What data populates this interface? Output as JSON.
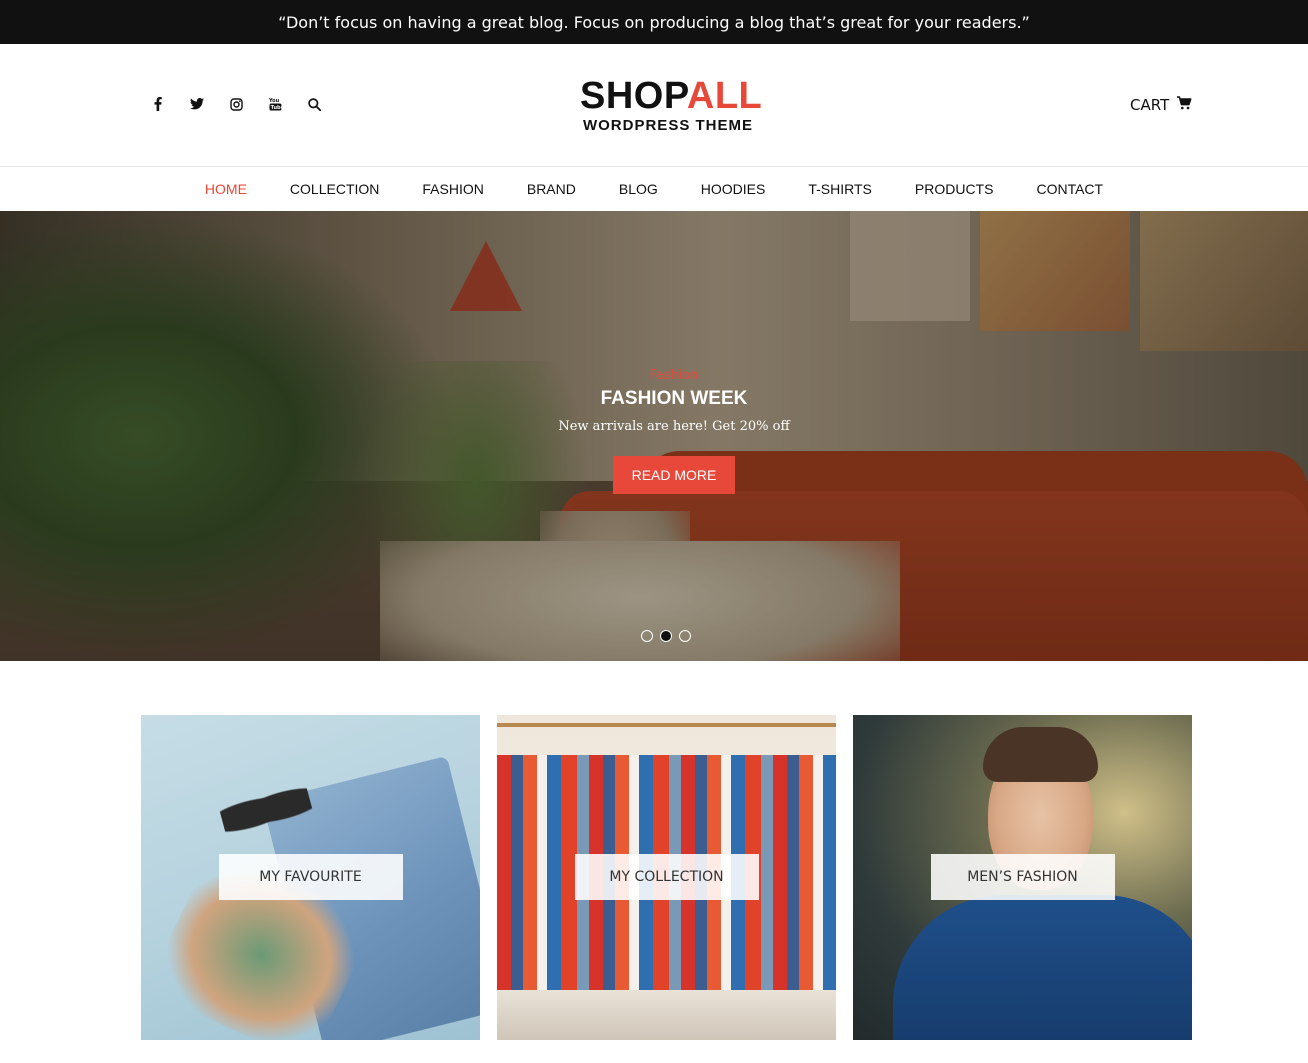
{
  "topbar": {
    "quote": "“Don’t focus on having a great blog. Focus on producing a blog that’s great for your readers.”"
  },
  "header": {
    "social_icons": [
      "facebook-icon",
      "twitter-icon",
      "instagram-icon",
      "youtube-icon",
      "search-icon"
    ],
    "logo": {
      "word_dark": "SHOP",
      "word_accent": "ALL",
      "subtitle": "WORDPRESS THEME"
    },
    "cart_label": "CART",
    "cart_icon": "cart-icon"
  },
  "nav": {
    "items": [
      {
        "label": "HOME",
        "active": true
      },
      {
        "label": "COLLECTION",
        "active": false
      },
      {
        "label": "FASHION",
        "active": false
      },
      {
        "label": "BRAND",
        "active": false
      },
      {
        "label": "BLOG",
        "active": false
      },
      {
        "label": "HOODIES",
        "active": false
      },
      {
        "label": "T-SHIRTS",
        "active": false
      },
      {
        "label": "PRODUCTS",
        "active": false
      },
      {
        "label": "CONTACT",
        "active": false
      }
    ]
  },
  "hero": {
    "category": "Fashion",
    "title": "FASHION WEEK",
    "description": "New arrivals are here! Get 20% off",
    "button_label": "READ MORE",
    "slides_count": 3,
    "active_slide": 2
  },
  "tiles": [
    {
      "label": "MY FAVOURITE"
    },
    {
      "label": "MY COLLECTION"
    },
    {
      "label": "MEN’S FASHION"
    }
  ],
  "colors": {
    "accent": "#e8483a",
    "topbar_bg": "#111111",
    "text": "#111111"
  }
}
